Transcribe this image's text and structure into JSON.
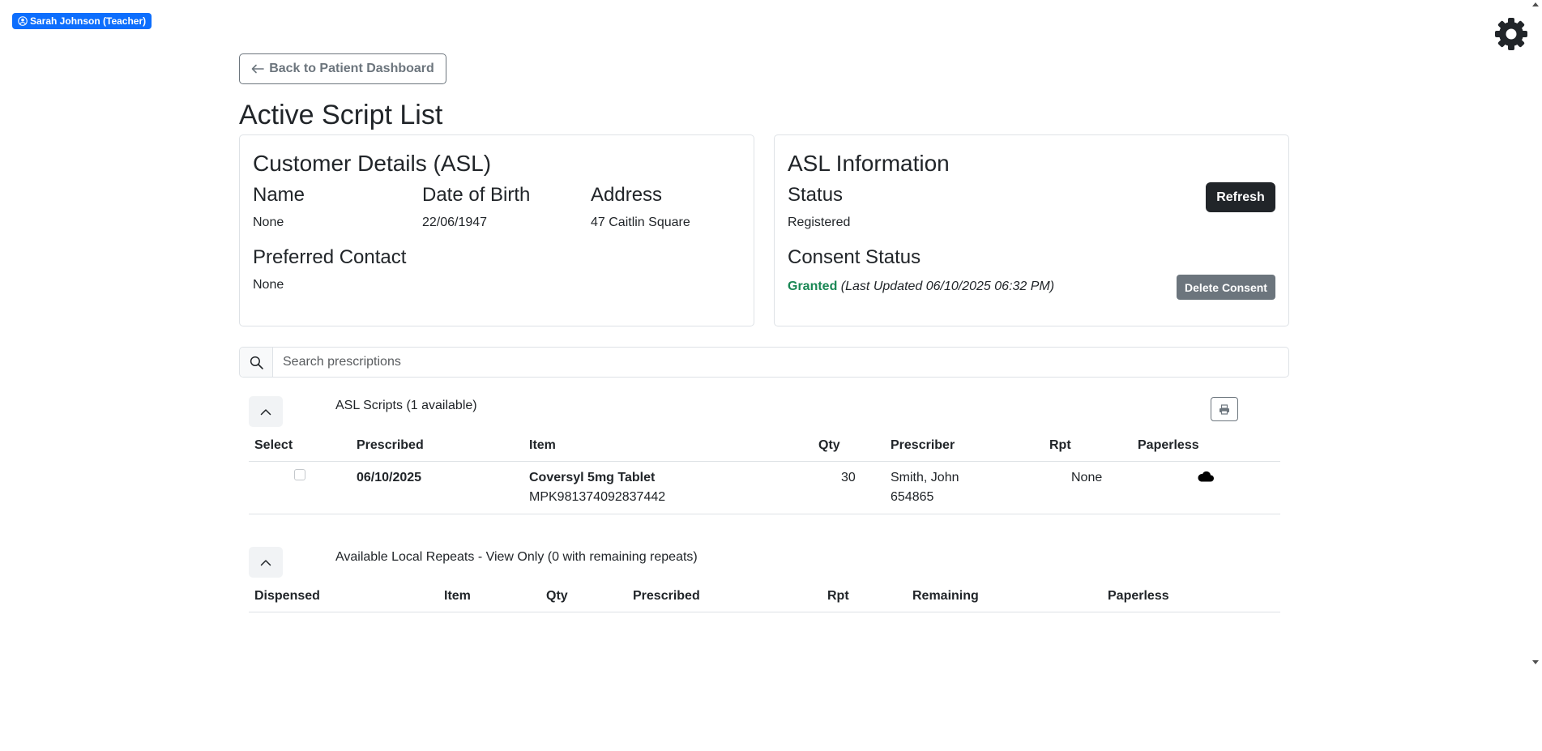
{
  "user": {
    "label": "Sarah Johnson (Teacher)"
  },
  "back_button": {
    "label": "Back to Patient Dashboard"
  },
  "page_title": "Active Script List",
  "customer": {
    "title": "Customer Details (ASL)",
    "name_label": "Name",
    "name_value": "None",
    "dob_label": "Date of Birth",
    "dob_value": "22/06/1947",
    "address_label": "Address",
    "address_value": "47 Caitlin Square",
    "contact_label": "Preferred Contact",
    "contact_value": "None"
  },
  "asl_info": {
    "title": "ASL Information",
    "status_label": "Status",
    "status_value": "Registered",
    "refresh_label": "Refresh",
    "consent_label": "Consent Status",
    "consent_value": "Granted",
    "consent_updated": "(Last Updated 06/10/2025 06:32 PM)",
    "delete_label": "Delete Consent"
  },
  "search": {
    "placeholder": "Search prescriptions",
    "value": ""
  },
  "asl_scripts": {
    "title": "ASL Scripts (1 available)",
    "headers": {
      "select": "Select",
      "prescribed": "Prescribed",
      "item": "Item",
      "qty": "Qty",
      "prescriber": "Prescriber",
      "rpt": "Rpt",
      "paperless": "Paperless"
    },
    "rows": [
      {
        "selected": false,
        "prescribed": "06/10/2025",
        "item_name": "Coversyl 5mg Tablet",
        "item_code": "MPK981374092837442",
        "qty": "30",
        "prescriber_name": "Smith, John",
        "prescriber_id": "654865",
        "rpt": "None",
        "paperless_icon": "cloud-icon"
      }
    ]
  },
  "local_repeats": {
    "title": "Available Local Repeats - View Only (0 with remaining repeats)",
    "headers": {
      "dispensed": "Dispensed",
      "item": "Item",
      "qty": "Qty",
      "prescribed": "Prescribed",
      "rpt": "Rpt",
      "remaining": "Remaining",
      "paperless": "Paperless"
    },
    "rows": []
  },
  "colors": {
    "primary": "#0d6efd",
    "dark": "#212529",
    "secondary": "#6c757d",
    "success": "#198754",
    "border": "#dee2e6"
  },
  "icons": [
    "user-circle-icon",
    "gear-icon",
    "arrow-left-icon",
    "search-icon",
    "chevron-up-icon",
    "printer-icon",
    "cloud-icon"
  ]
}
